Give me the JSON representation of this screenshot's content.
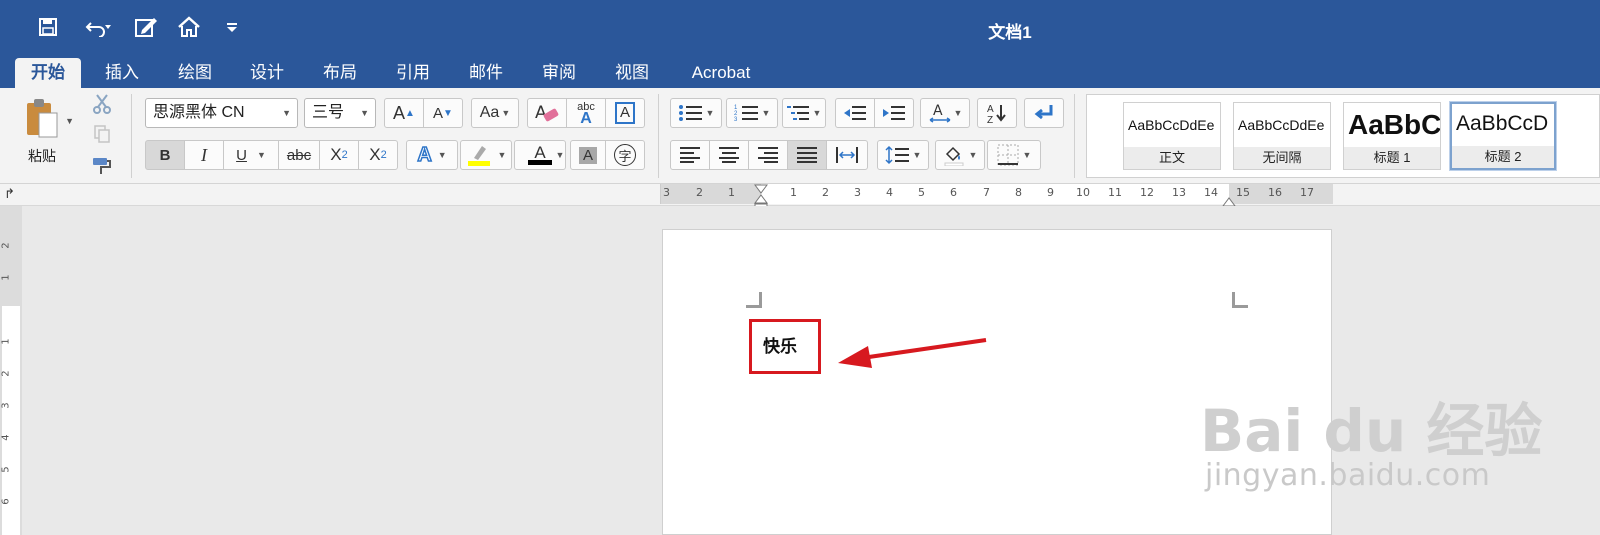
{
  "window": {
    "title": "文档1"
  },
  "quick_access": {
    "icons": [
      "save-icon",
      "undo-icon",
      "edit-icon",
      "home-icon",
      "customize-icon"
    ]
  },
  "tabs": [
    {
      "label": "开始",
      "active": true
    },
    {
      "label": "插入",
      "active": false
    },
    {
      "label": "绘图",
      "active": false
    },
    {
      "label": "设计",
      "active": false
    },
    {
      "label": "布局",
      "active": false
    },
    {
      "label": "引用",
      "active": false
    },
    {
      "label": "邮件",
      "active": false
    },
    {
      "label": "审阅",
      "active": false
    },
    {
      "label": "视图",
      "active": false
    },
    {
      "label": "Acrobat",
      "active": false
    }
  ],
  "clipboard": {
    "paste_label": "粘贴"
  },
  "font": {
    "family": "思源黑体 CN",
    "size": "三号"
  },
  "format_buttons": {
    "bold": "B",
    "italic": "I",
    "underline": "U",
    "strike": "abc",
    "subscript": "X",
    "subscript_sub": "2",
    "superscript": "X",
    "superscript_sup": "2",
    "grow": "A",
    "shrink": "A",
    "change_case": "Aa",
    "abc_label": "abc",
    "abc_a": "A",
    "box_a": "A",
    "effect_a": "A",
    "font_color_a": "A",
    "shade_a": "A",
    "phonetic": "字"
  },
  "styles": [
    {
      "sample": "AaBbCcDdEe",
      "label": "正文",
      "selected": false,
      "size": "normal"
    },
    {
      "sample": "AaBbCcDdEe",
      "label": "无间隔",
      "selected": false,
      "size": "normal"
    },
    {
      "sample": "AaBbC",
      "label": "标题 1",
      "selected": false,
      "size": "large"
    },
    {
      "sample": "AaBbCcD",
      "label": "标题 2",
      "selected": true,
      "size": "medium"
    }
  ],
  "ruler": {
    "left_numbers": [
      "3",
      "2",
      "1"
    ],
    "right_numbers": [
      "1",
      "2",
      "3",
      "4",
      "5",
      "6",
      "7",
      "8",
      "9",
      "10",
      "11",
      "12",
      "13",
      "14",
      "15",
      "16",
      "17"
    ]
  },
  "vruler_numbers": [
    "2",
    "1",
    "1",
    "2",
    "3",
    "4",
    "5",
    "6"
  ],
  "document": {
    "text": "快乐"
  },
  "watermark": {
    "logo": "Bai du 经验",
    "url": "jingyan.baidu.com"
  },
  "colors": {
    "titlebar": "#2b579a",
    "highlight_box": "#d7191f",
    "arrow": "#d7191f",
    "highlight_yellow": "#ffff00"
  }
}
